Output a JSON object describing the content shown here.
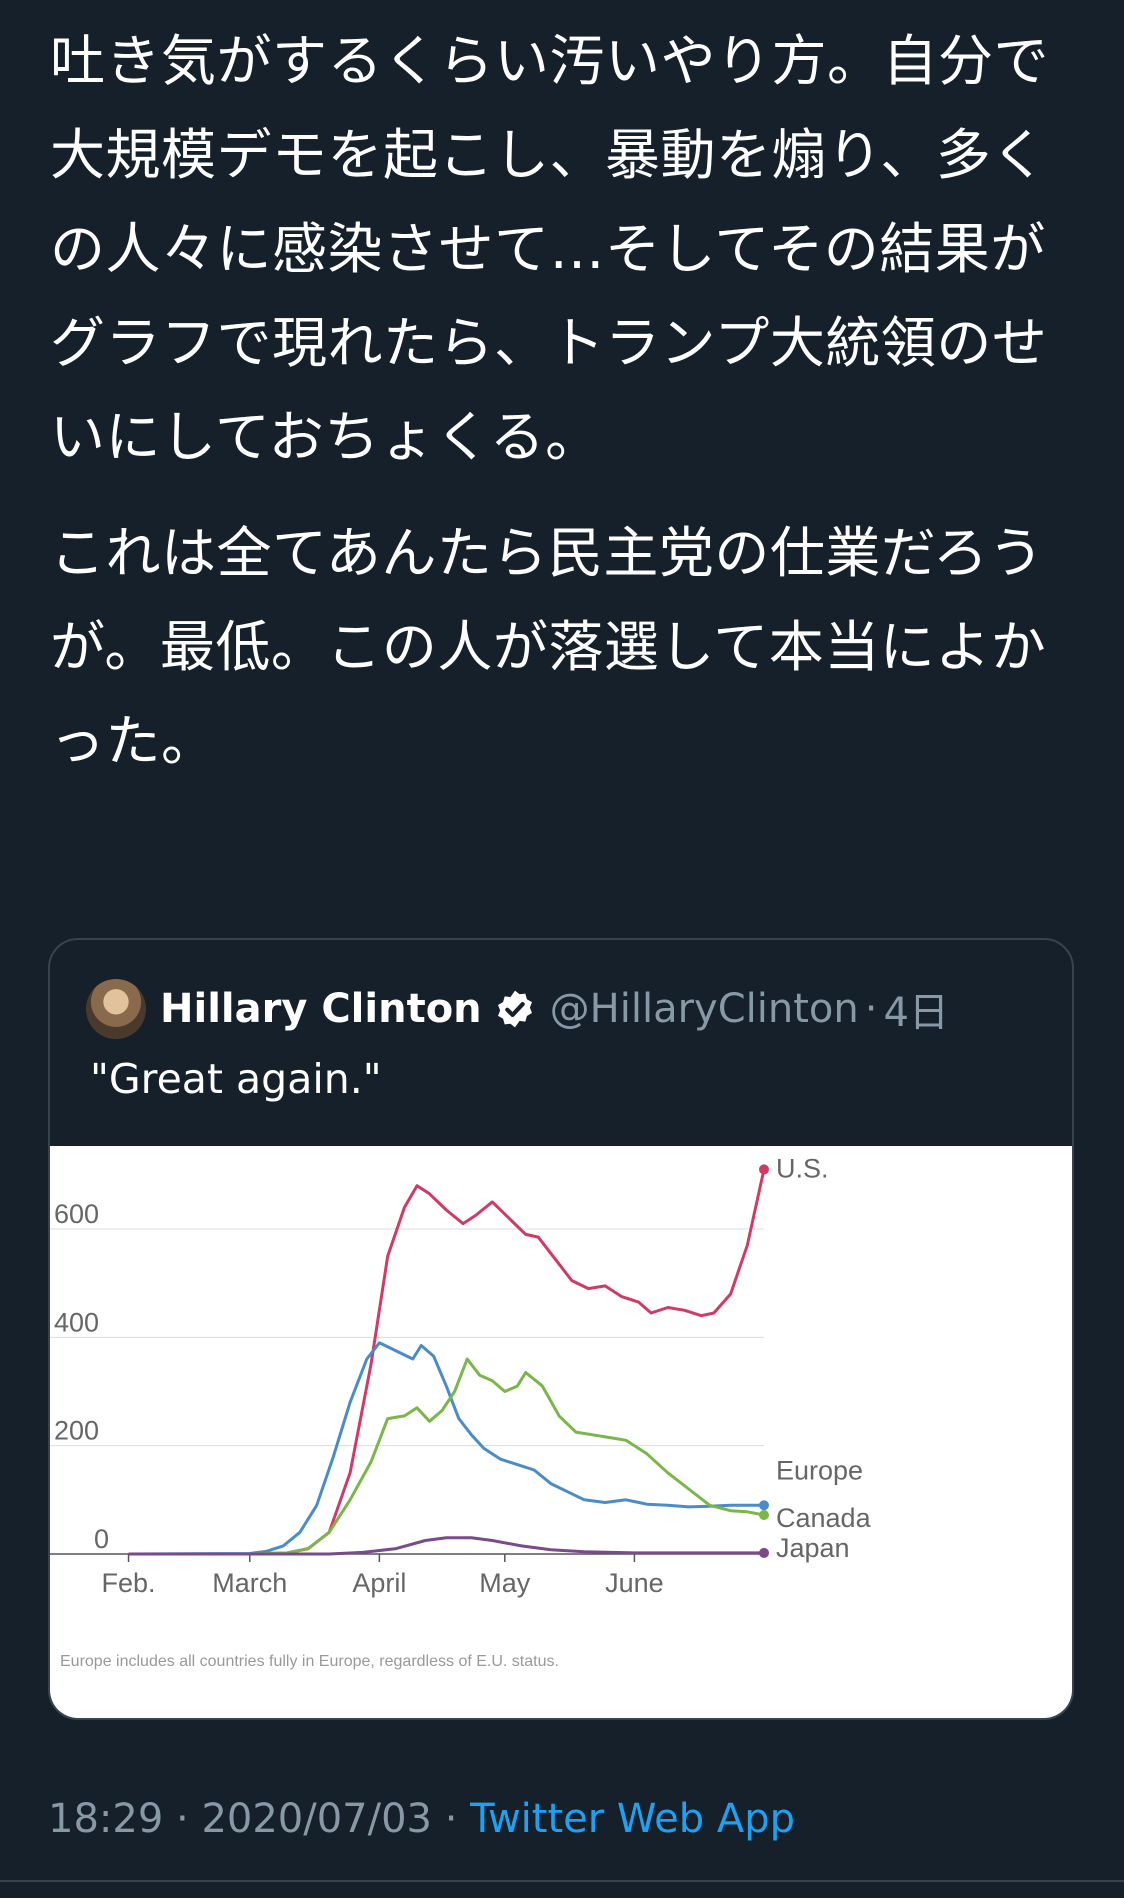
{
  "tweet": {
    "paragraphs": [
      "吐き気がするくらい汚いやり方。自分で大規模デモを起こし、暴動を煽り、多くの人々に感染させて…そしてその結果がグラフで現れたら、トランプ大統領のせいにしておちょくる。",
      "これは全てあんたら民主党の仕業だろうが。最低。この人が落選して本当によかった。"
    ],
    "time": "18:29",
    "separator": "·",
    "date": "2020/07/03",
    "source": "Twitter Web App"
  },
  "quote": {
    "display_name": "Hillary Clinton",
    "verified_icon": "verified-badge-icon",
    "handle": "@HillaryClinton",
    "separator": "·",
    "age": "4日",
    "text": "\"Great again.\""
  },
  "colors": {
    "background": "#15202b",
    "link": "#1da1f2",
    "muted": "#8899a6",
    "border": "#38444d",
    "us": "#d23a64",
    "europe": "#4a8cca",
    "canada": "#7ab648",
    "japan": "#7a4a8a"
  },
  "chart_data": {
    "type": "line",
    "x_range": [
      "2020-01-29",
      "2020-07-02"
    ],
    "xtick_labels": [
      {
        "date": "2020-02-01",
        "label": "Feb."
      },
      {
        "date": "2020-03-01",
        "label": "March"
      },
      {
        "date": "2020-04-01",
        "label": "April"
      },
      {
        "date": "2020-05-01",
        "label": "May"
      },
      {
        "date": "2020-06-01",
        "label": "June"
      }
    ],
    "yticks": [
      0,
      200,
      400,
      600
    ],
    "ylim": [
      0,
      720
    ],
    "grid": true,
    "note": "Europe includes all countries fully in Europe, regardless of E.U. status.",
    "series": [
      {
        "name": "U.S.",
        "color": "#d23a64",
        "points": [
          [
            "2020-02-01",
            0
          ],
          [
            "2020-03-01",
            0
          ],
          [
            "2020-03-10",
            2
          ],
          [
            "2020-03-15",
            10
          ],
          [
            "2020-03-20",
            40
          ],
          [
            "2020-03-25",
            150
          ],
          [
            "2020-03-30",
            350
          ],
          [
            "2020-04-03",
            550
          ],
          [
            "2020-04-07",
            640
          ],
          [
            "2020-04-10",
            680
          ],
          [
            "2020-04-13",
            665
          ],
          [
            "2020-04-17",
            635
          ],
          [
            "2020-04-21",
            610
          ],
          [
            "2020-04-24",
            625
          ],
          [
            "2020-04-28",
            650
          ],
          [
            "2020-05-02",
            620
          ],
          [
            "2020-05-06",
            590
          ],
          [
            "2020-05-09",
            585
          ],
          [
            "2020-05-13",
            545
          ],
          [
            "2020-05-17",
            505
          ],
          [
            "2020-05-21",
            490
          ],
          [
            "2020-05-25",
            495
          ],
          [
            "2020-05-29",
            475
          ],
          [
            "2020-06-02",
            465
          ],
          [
            "2020-06-05",
            445
          ],
          [
            "2020-06-09",
            455
          ],
          [
            "2020-06-13",
            450
          ],
          [
            "2020-06-17",
            440
          ],
          [
            "2020-06-20",
            445
          ],
          [
            "2020-06-24",
            480
          ],
          [
            "2020-06-28",
            570
          ],
          [
            "2020-07-02",
            710
          ]
        ]
      },
      {
        "name": "Europe",
        "color": "#4a8cca",
        "points": [
          [
            "2020-02-01",
            0
          ],
          [
            "2020-03-01",
            1
          ],
          [
            "2020-03-05",
            5
          ],
          [
            "2020-03-09",
            15
          ],
          [
            "2020-03-13",
            40
          ],
          [
            "2020-03-17",
            90
          ],
          [
            "2020-03-21",
            180
          ],
          [
            "2020-03-25",
            280
          ],
          [
            "2020-03-29",
            360
          ],
          [
            "2020-04-01",
            390
          ],
          [
            "2020-04-05",
            375
          ],
          [
            "2020-04-09",
            360
          ],
          [
            "2020-04-11",
            385
          ],
          [
            "2020-04-14",
            365
          ],
          [
            "2020-04-17",
            310
          ],
          [
            "2020-04-20",
            250
          ],
          [
            "2020-04-23",
            220
          ],
          [
            "2020-04-26",
            195
          ],
          [
            "2020-04-30",
            175
          ],
          [
            "2020-05-04",
            165
          ],
          [
            "2020-05-08",
            155
          ],
          [
            "2020-05-12",
            130
          ],
          [
            "2020-05-16",
            115
          ],
          [
            "2020-05-20",
            100
          ],
          [
            "2020-05-25",
            95
          ],
          [
            "2020-05-30",
            100
          ],
          [
            "2020-06-04",
            92
          ],
          [
            "2020-06-09",
            90
          ],
          [
            "2020-06-14",
            87
          ],
          [
            "2020-06-19",
            88
          ],
          [
            "2020-06-24",
            90
          ],
          [
            "2020-07-02",
            90
          ]
        ]
      },
      {
        "name": "Canada",
        "color": "#7ab648",
        "points": [
          [
            "2020-02-01",
            0
          ],
          [
            "2020-03-01",
            0
          ],
          [
            "2020-03-10",
            2
          ],
          [
            "2020-03-15",
            10
          ],
          [
            "2020-03-20",
            40
          ],
          [
            "2020-03-25",
            100
          ],
          [
            "2020-03-30",
            170
          ],
          [
            "2020-04-03",
            250
          ],
          [
            "2020-04-07",
            255
          ],
          [
            "2020-04-10",
            270
          ],
          [
            "2020-04-13",
            245
          ],
          [
            "2020-04-16",
            265
          ],
          [
            "2020-04-19",
            300
          ],
          [
            "2020-04-22",
            360
          ],
          [
            "2020-04-25",
            330
          ],
          [
            "2020-04-28",
            320
          ],
          [
            "2020-05-01",
            300
          ],
          [
            "2020-05-04",
            310
          ],
          [
            "2020-05-06",
            335
          ],
          [
            "2020-05-10",
            310
          ],
          [
            "2020-05-14",
            255
          ],
          [
            "2020-05-18",
            225
          ],
          [
            "2020-05-22",
            220
          ],
          [
            "2020-05-26",
            215
          ],
          [
            "2020-05-30",
            210
          ],
          [
            "2020-06-04",
            185
          ],
          [
            "2020-06-09",
            150
          ],
          [
            "2020-06-14",
            120
          ],
          [
            "2020-06-19",
            90
          ],
          [
            "2020-06-24",
            80
          ],
          [
            "2020-06-28",
            78
          ],
          [
            "2020-07-02",
            72
          ]
        ]
      },
      {
        "name": "Japan",
        "color": "#7a4a8a",
        "points": [
          [
            "2020-02-01",
            0
          ],
          [
            "2020-03-20",
            0
          ],
          [
            "2020-03-28",
            3
          ],
          [
            "2020-04-05",
            10
          ],
          [
            "2020-04-12",
            25
          ],
          [
            "2020-04-17",
            30
          ],
          [
            "2020-04-23",
            30
          ],
          [
            "2020-04-28",
            25
          ],
          [
            "2020-05-05",
            15
          ],
          [
            "2020-05-12",
            8
          ],
          [
            "2020-05-20",
            4
          ],
          [
            "2020-06-01",
            2
          ],
          [
            "2020-07-02",
            2
          ]
        ]
      }
    ]
  }
}
